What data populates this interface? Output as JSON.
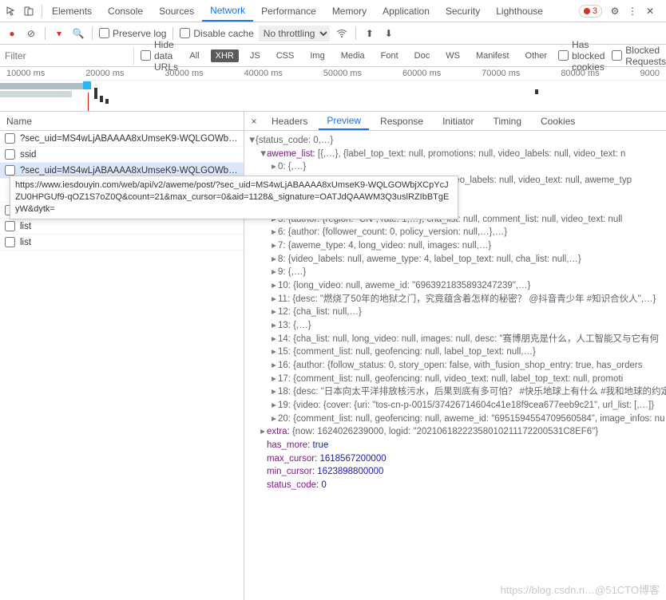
{
  "topTabs": [
    "Elements",
    "Console",
    "Sources",
    "Network",
    "Performance",
    "Memory",
    "Application",
    "Security",
    "Lighthouse"
  ],
  "topActive": 3,
  "errors": "3",
  "toolbar": {
    "preserve": "Preserve log",
    "disable": "Disable cache",
    "throttling": "No throttling"
  },
  "filter": {
    "placeholder": "Filter",
    "hide": "Hide data URLs",
    "types": [
      "All",
      "XHR",
      "JS",
      "CSS",
      "Img",
      "Media",
      "Font",
      "Doc",
      "WS",
      "Manifest",
      "Other"
    ],
    "typeActive": 1,
    "blocked1": "Has blocked cookies",
    "blocked2": "Blocked Requests"
  },
  "timeline": {
    "labels": [
      "10000 ms",
      "20000 ms",
      "30000 ms",
      "40000 ms",
      "50000 ms",
      "60000 ms",
      "70000 ms",
      "80000 ms",
      "9000"
    ]
  },
  "leftHdr": "Name",
  "requests": [
    "?sec_uid=MS4wLjABAAAA8xUmseK9-WQLGOWbjXCpYcJZ…",
    "ssid",
    "?sec_uid=MS4wLjABAAAA8xUmseK9-WQLGOWbjXCpYcJZ…",
    "list",
    "list",
    "list"
  ],
  "requestSelected": 2,
  "tooltip": "https://www.iesdouyin.com/web/api/v2/aweme/post/?sec_uid=MS4wLjABAAAA8xUmseK9-WQLGOWbjXCpYcJZU0HPGUf9-qOZ1S7oZ0Q&count=21&max_cursor=0&aid=1128&_signature=OATJdQAAWM3Q3uslRZIbBTgEyW&dytk=",
  "rightTabs": [
    "Headers",
    "Preview",
    "Response",
    "Initiator",
    "Timing",
    "Cookies"
  ],
  "rightActive": 1,
  "preview": {
    "top": "{status_code: 0,…}",
    "aweme_list": "[{,…}, {label_top_text: null, promotions: null, video_labels: null, video_text: n",
    "items": [
      "0: {,…}",
      "1: {label_top_text: null, promotions: null, video_labels: null, video_text: null, aweme_typ",
      "",
      "",
      "5: {author: {region: \"CN\", rate: 1,…}, cha_list: null, comment_list: null, video_text: null",
      "6: {author: {follower_count: 0, policy_version: null,…},…}",
      "7: {aweme_type: 4, long_video: null, images: null,…}",
      "8: {video_labels: null, aweme_type: 4, label_top_text: null, cha_list: null,…}",
      "9: {,…}",
      "10: {long_video: null, aweme_id: \"6963921835893247239\",…}",
      "11: {desc: \"燃烧了50年的地狱之门，究竟蕴含着怎样的秘密？ @抖音青少年 #知识合伙人\",…}",
      "12: {cha_list: null,…}",
      "13: {,…}",
      "14: {cha_list: null, long_video: null, images: null, desc: \"赛博朋克是什么，人工智能又与它有何",
      "15: {comment_list: null, geofencing: null, label_top_text: null,…}",
      "16: {author: {follow_status: 0, story_open: false, with_fusion_shop_entry: true, has_orders",
      "17: {comment_list: null, geofencing: null, video_text: null, label_top_text: null, promoti",
      "18: {desc: \"日本向太平洋排放核污水，后果到底有多可怕？ #快乐地球上有什么 #我和地球的约定\", cha_li",
      "19: {video: {cover: {uri: \"tos-cn-p-0015/37426714604c41e18f9cea677eeb9c21\", url_list: [,…]}",
      "20: {comment_list: null, geofencing: null, aweme_id: \"6951594554709560584\", image_infos: nu"
    ],
    "extra": "{now: 1624026239000, logid: \"20210618222358010211172200531C8EF6\"}",
    "has_more": "true",
    "max_cursor": "1618567200000",
    "min_cursor": "1623898800000",
    "status_code": "0"
  },
  "watermark": "https://blog.csdn.n…@51CTO博客"
}
